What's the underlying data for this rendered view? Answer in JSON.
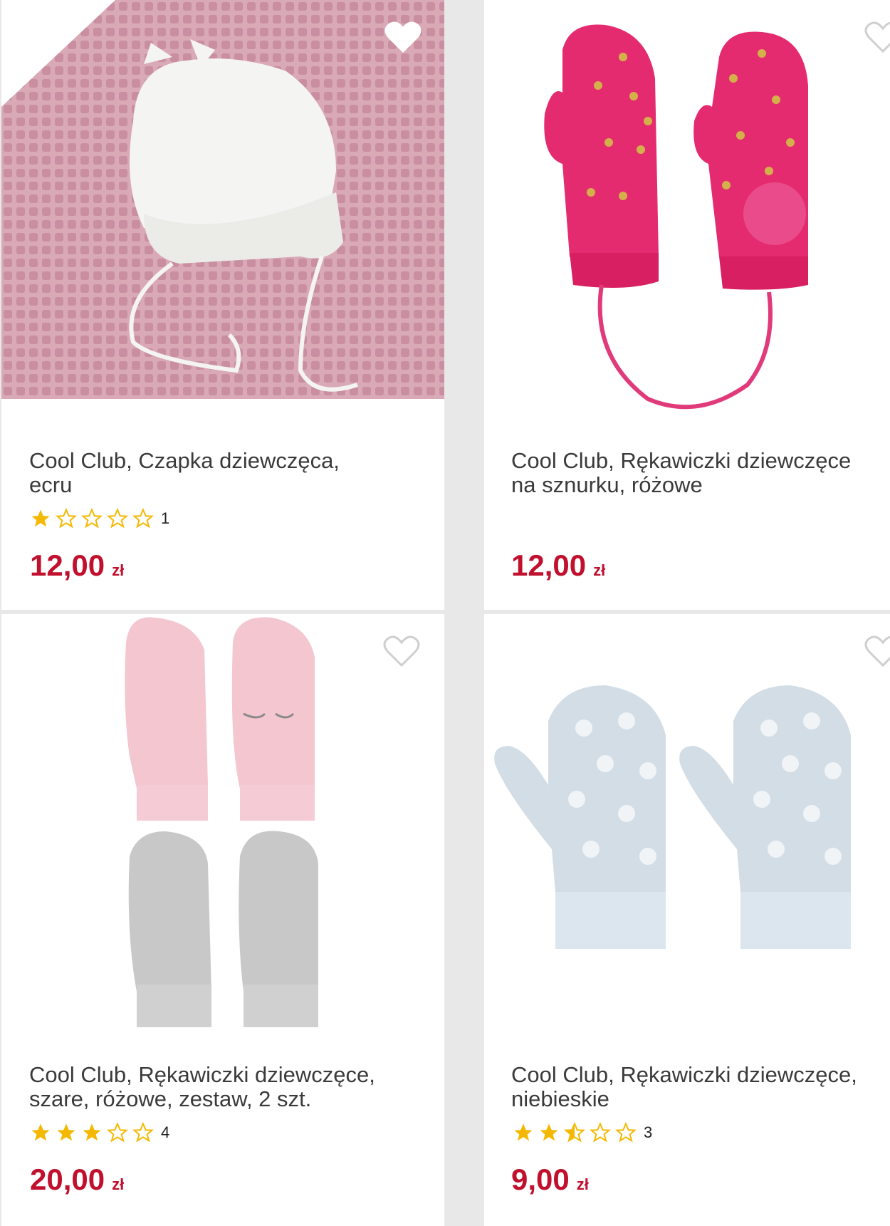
{
  "products": [
    {
      "title_line1": "Cool Club, Czapka dziewczęca,",
      "title_line2": "ecru",
      "rating_count": "1",
      "price_amount": "12,00",
      "currency": "zł",
      "rating": 1,
      "favorite_icon": "heart-outline-icon"
    },
    {
      "title_line1": "Cool Club, Rękawiczki dziewczęce",
      "title_line2": "na sznurku, różowe",
      "rating_count": "",
      "price_amount": "12,00",
      "currency": "zł",
      "rating": 0,
      "favorite_icon": "heart-outline-icon"
    },
    {
      "title_line1": "Cool Club, Rękawiczki dziewczęce,",
      "title_line2": "szare, różowe, zestaw, 2 szt.",
      "rating_count": "4",
      "price_amount": "20,00",
      "currency": "zł",
      "rating": 3,
      "favorite_icon": "heart-outline-icon"
    },
    {
      "title_line1": "Cool Club, Rękawiczki dziewczęce,",
      "title_line2": "niebieskie",
      "rating_count": "3",
      "price_amount": "9,00",
      "currency": "zł",
      "rating": 2.5,
      "favorite_icon": "heart-outline-icon"
    }
  ],
  "colors": {
    "price": "#c0102e",
    "star": "#f5b800",
    "title": "#3a3a3a"
  }
}
